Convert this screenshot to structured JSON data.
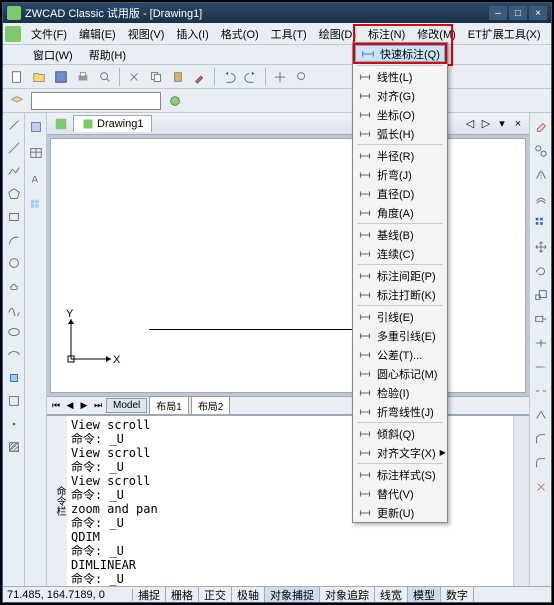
{
  "title": "ZWCAD Classic 试用版 - [Drawing1]",
  "menu": [
    "文件(F)",
    "编辑(E)",
    "视图(V)",
    "插入(I)",
    "格式(O)",
    "工具(T)",
    "绘图(D)",
    "标注(N)",
    "修改(M)",
    "ET扩展工具(X)"
  ],
  "menu2": [
    "窗口(W)",
    "帮助(H)"
  ],
  "drawing_tab": "Drawing1",
  "layout": {
    "tabs": [
      "Model",
      "布局1",
      "布局2"
    ],
    "active": 0
  },
  "cmd_lines": "View scroll\n命令: _U\nView scroll\n命令: _U\nView scroll\n命令: _U\nzoom and pan\n命令: _U\nQDIM\n命令: _U\nDIMLINEAR\n命令: _U\n另一角点:\n命令:",
  "cmd_side": "命令栏",
  "status": {
    "coord": "71.485, 164.7189, 0",
    "buttons": [
      "捕捉",
      "栅格",
      "正交",
      "极轴",
      "对象捕捉",
      "对象追踪",
      "线宽",
      "模型",
      "数字"
    ]
  },
  "dropdown": {
    "highlighted": "快速标注(Q)",
    "groups": [
      [
        "线性(L)",
        "对齐(G)",
        "坐标(O)",
        "弧长(H)"
      ],
      [
        "半径(R)",
        "折弯(J)",
        "直径(D)",
        "角度(A)"
      ],
      [
        "基线(B)",
        "连续(C)"
      ],
      [
        "标注间距(P)",
        "标注打断(K)"
      ],
      [
        "引线(E)",
        "多重引线(E)",
        "公差(T)...",
        "圆心标记(M)",
        "检验(I)",
        "折弯线性(J)"
      ],
      [
        "倾斜(Q)",
        "对齐文字(X)"
      ],
      [
        "标注样式(S)",
        "替代(V)",
        "更新(U)"
      ]
    ]
  }
}
